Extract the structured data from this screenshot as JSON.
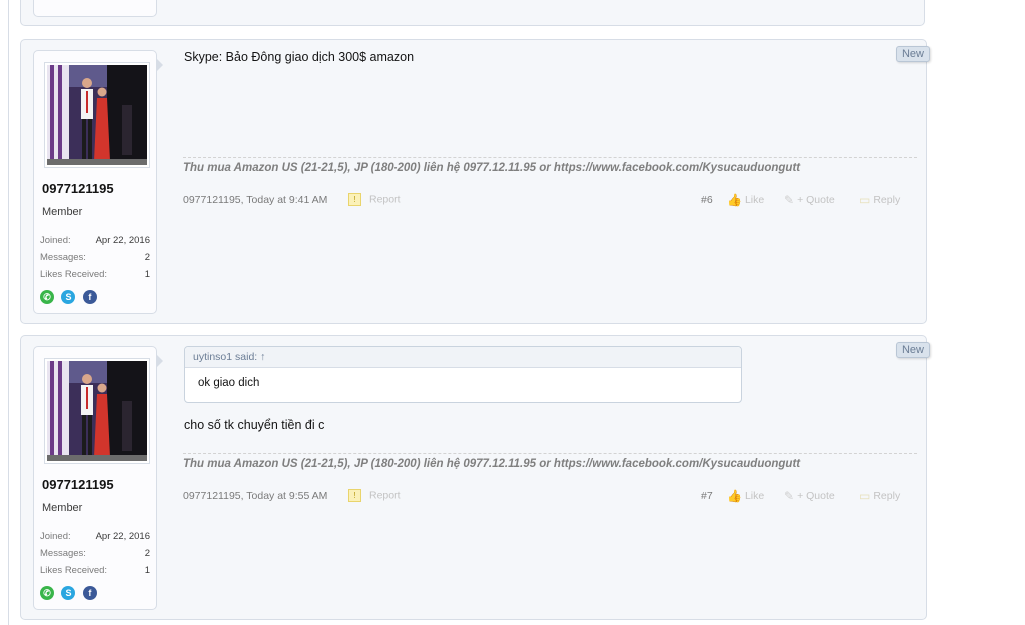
{
  "posts": [
    {
      "badge": "New",
      "user": {
        "name": "0977121195",
        "title": "Member",
        "joined_label": "Joined:",
        "joined": "Apr 22, 2016",
        "messages_label": "Messages:",
        "messages": "2",
        "likes_label": "Likes Received:",
        "likes": "1"
      },
      "message": "Skype: Bảo Đông giao dịch 300$ amazon",
      "signature": "Thu mua Amazon US (21-21,5), JP (180-200) liên hệ 0977.12.11.95 or https://www.facebook.com/Kysucauduongutt",
      "meta": {
        "author_time": "0977121195, Today at 9:41 AM",
        "report": "Report",
        "post_number": "#6",
        "like": "Like",
        "quote": "+ Quote",
        "reply": "Reply"
      }
    },
    {
      "badge": "New",
      "user": {
        "name": "0977121195",
        "title": "Member",
        "joined_label": "Joined:",
        "joined": "Apr 22, 2016",
        "messages_label": "Messages:",
        "messages": "2",
        "likes_label": "Likes Received:",
        "likes": "1"
      },
      "quote": {
        "author": "uytinso1 said:",
        "arrow": "↑",
        "text": "ok giao dich"
      },
      "message": "cho số tk chuyển tiền đi c",
      "signature": "Thu mua Amazon US (21-21,5), JP (180-200) liên hệ 0977.12.11.95 or https://www.facebook.com/Kysucauduongutt",
      "meta": {
        "author_time": "0977121195, Today at 9:55 AM",
        "report": "Report",
        "post_number": "#7",
        "like": "Like",
        "quote": "+ Quote",
        "reply": "Reply"
      }
    }
  ],
  "icons": {
    "phone": "phone-icon",
    "skype": "skype-icon",
    "facebook": "facebook-icon",
    "report": "report-icon",
    "like": "like-icon",
    "quote": "quote-icon",
    "reply": "reply-icon"
  }
}
